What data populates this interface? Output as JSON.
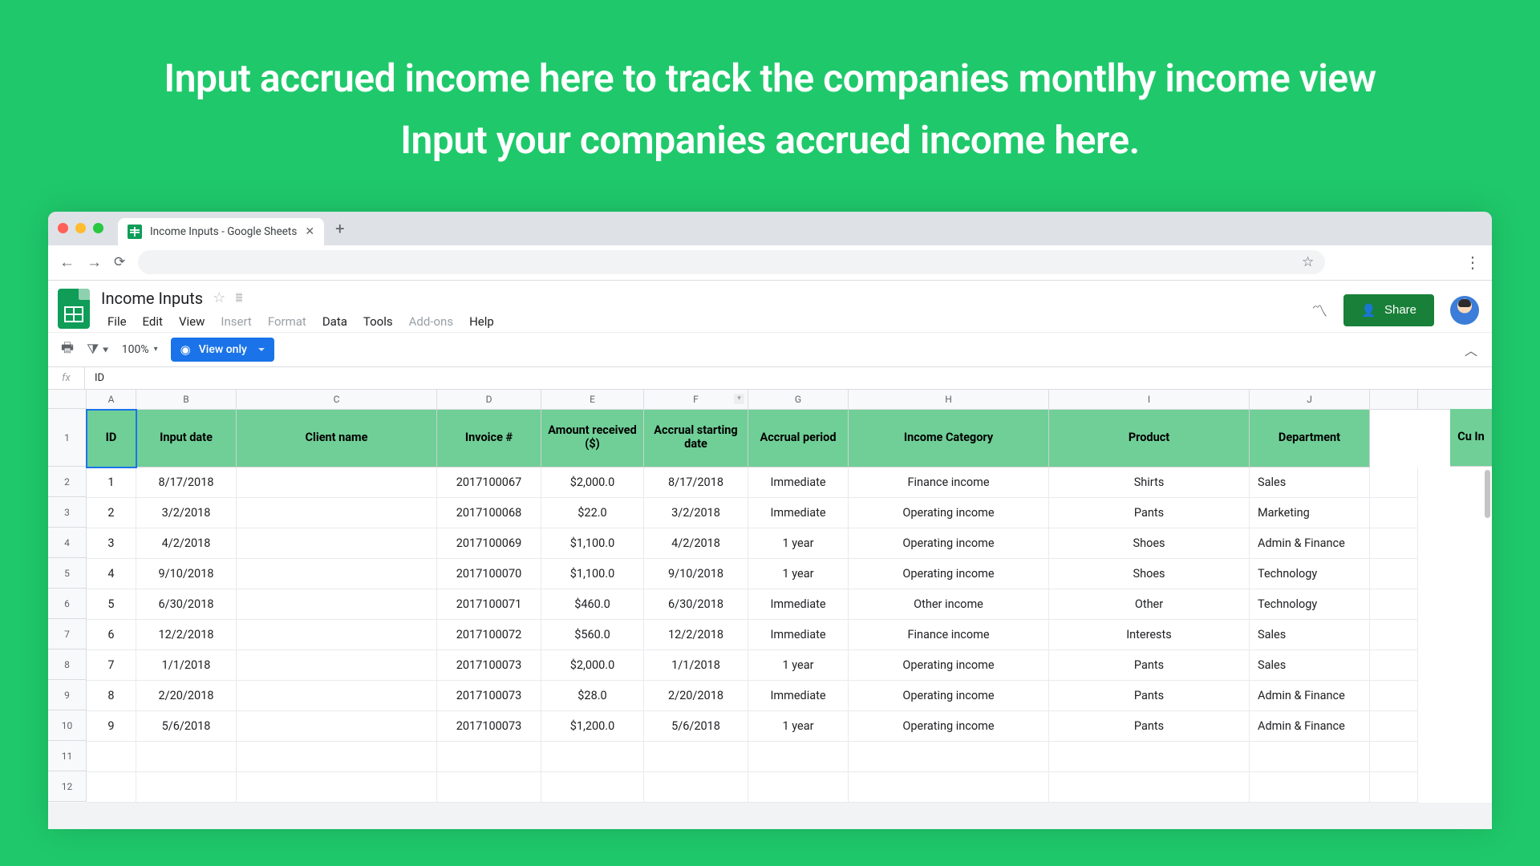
{
  "hero": "Input accrued income here to track the companies montlhy income view Input your companies accrued income here.",
  "browser": {
    "tab_title": "Income Inputs - Google Sheets"
  },
  "sheets": {
    "doc_title": "Income Inputs",
    "menu": [
      "File",
      "Edit",
      "View",
      "Insert",
      "Format",
      "Data",
      "Tools",
      "Add-ons",
      "Help"
    ],
    "menu_disabled": [
      "Insert",
      "Format",
      "Add-ons"
    ],
    "share_label": "Share",
    "zoom": "100%",
    "view_only": "View only",
    "fx_value": "ID"
  },
  "columns": [
    "A",
    "B",
    "C",
    "D",
    "E",
    "F",
    "G",
    "H",
    "I",
    "J"
  ],
  "headers": [
    "ID",
    "Input date",
    "Client name",
    "Invoice #",
    "Amount received ($)",
    "Accrual starting date",
    "Accrual period",
    "Income Category",
    "Product",
    "Department"
  ],
  "cut_header": "Cu\nIn",
  "row_numbers": [
    "1",
    "2",
    "3",
    "4",
    "5",
    "6",
    "7",
    "8",
    "9",
    "10",
    "11",
    "12"
  ],
  "chart_data": {
    "type": "table",
    "columns": [
      "ID",
      "Input date",
      "Client name",
      "Invoice #",
      "Amount received ($)",
      "Accrual starting date",
      "Accrual period",
      "Income Category",
      "Product",
      "Department"
    ],
    "rows": [
      [
        "1",
        "8/17/2018",
        "",
        "2017100067",
        "$2,000.0",
        "8/17/2018",
        "Immediate",
        "Finance income",
        "Shirts",
        "Sales"
      ],
      [
        "2",
        "3/2/2018",
        "",
        "2017100068",
        "$22.0",
        "3/2/2018",
        "Immediate",
        "Operating income",
        "Pants",
        "Marketing"
      ],
      [
        "3",
        "4/2/2018",
        "",
        "2017100069",
        "$1,100.0",
        "4/2/2018",
        "1 year",
        "Operating income",
        "Shoes",
        "Admin & Finance"
      ],
      [
        "4",
        "9/10/2018",
        "",
        "2017100070",
        "$1,100.0",
        "9/10/2018",
        "1 year",
        "Operating income",
        "Shoes",
        "Technology"
      ],
      [
        "5",
        "6/30/2018",
        "",
        "2017100071",
        "$460.0",
        "6/30/2018",
        "Immediate",
        "Other income",
        "Other",
        "Technology"
      ],
      [
        "6",
        "12/2/2018",
        "",
        "2017100072",
        "$560.0",
        "12/2/2018",
        "Immediate",
        "Finance income",
        "Interests",
        "Sales"
      ],
      [
        "7",
        "1/1/2018",
        "",
        "2017100073",
        "$2,000.0",
        "1/1/2018",
        "1 year",
        "Operating income",
        "Pants",
        "Sales"
      ],
      [
        "8",
        "2/20/2018",
        "",
        "2017100073",
        "$28.0",
        "2/20/2018",
        "Immediate",
        "Operating income",
        "Pants",
        "Admin & Finance"
      ],
      [
        "9",
        "5/6/2018",
        "",
        "2017100073",
        "$1,200.0",
        "5/6/2018",
        "1 year",
        "Operating income",
        "Pants",
        "Admin & Finance"
      ]
    ]
  }
}
